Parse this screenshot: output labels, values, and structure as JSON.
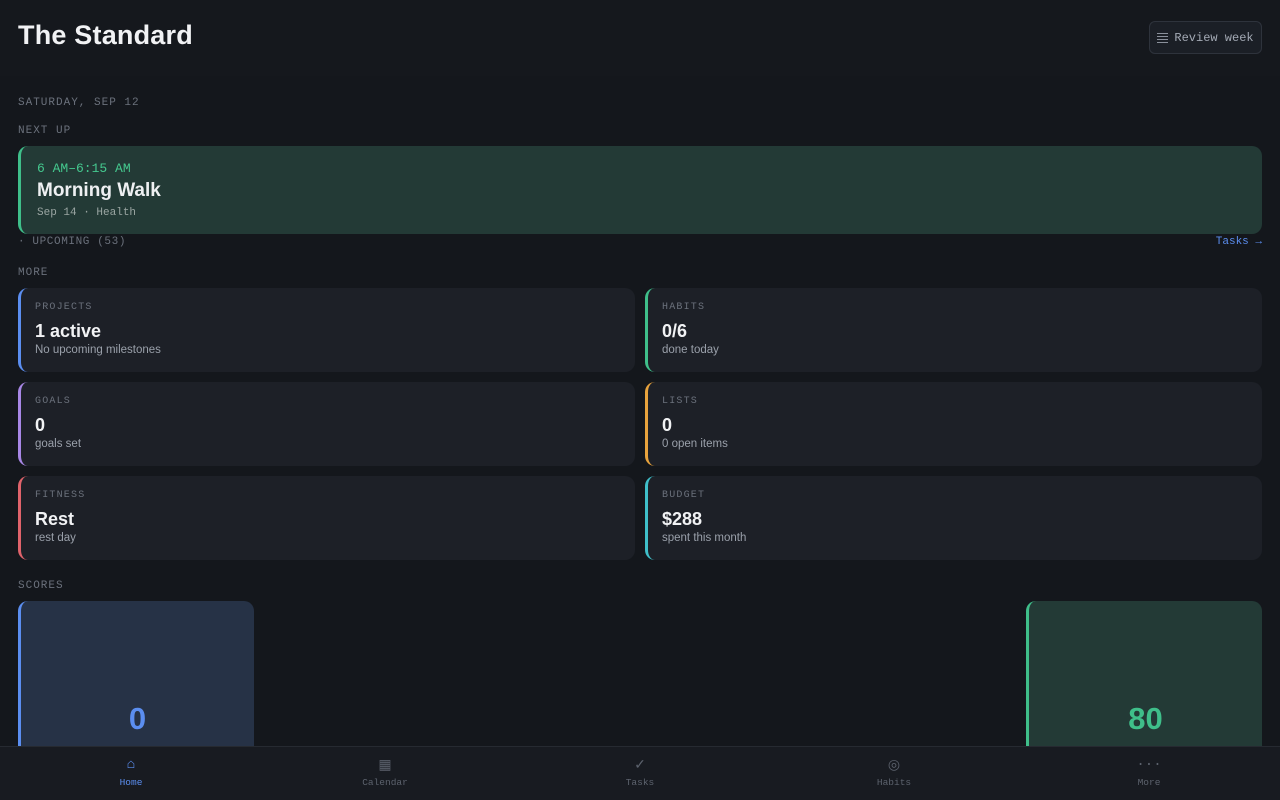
{
  "header": {
    "title": "The Standard",
    "review_label": "Review week",
    "review_icon": "list-icon"
  },
  "date_label": "SATURDAY, SEP 12",
  "next_up": {
    "section_label": "NEXT UP",
    "time": "6 AM–6:15 AM",
    "title": "Morning Walk",
    "meta": "Sep 14 · Health",
    "accent": "#3fbf8a"
  },
  "upcoming": {
    "label": "· UPCOMING (53)",
    "tasks_link": "Tasks →"
  },
  "more": {
    "section_label": "MORE",
    "tiles": [
      {
        "label": "PROJECTS",
        "value": "1 active",
        "sub": "No upcoming milestones",
        "accent": "#5b8ef0"
      },
      {
        "label": "HABITS",
        "value": "0/6",
        "sub": "done today",
        "accent": "#3fbf8a"
      },
      {
        "label": "GOALS",
        "value": "0",
        "sub": "goals set",
        "accent": "#a887e6"
      },
      {
        "label": "LISTS",
        "value": "0",
        "sub": "0 open items",
        "accent": "#e8a33d"
      },
      {
        "label": "FITNESS",
        "value": "Rest",
        "sub": "rest day",
        "accent": "#e0636b"
      },
      {
        "label": "BUDGET",
        "value": "$288",
        "sub": "spent this month",
        "accent": "#3fbfc9"
      }
    ]
  },
  "scores": {
    "section_label": "SCORES",
    "items": [
      {
        "value": "0",
        "color": "#5b8ef0",
        "bg": "#263246"
      },
      {
        "value": "80",
        "color": "#3fbf8a",
        "bg": "#233a36"
      }
    ]
  },
  "nav": {
    "items": [
      {
        "label": "Home",
        "icon": "home-icon",
        "glyph": "⌂",
        "active": true
      },
      {
        "label": "Calendar",
        "icon": "calendar-icon",
        "glyph": "▦",
        "active": false
      },
      {
        "label": "Tasks",
        "icon": "check-icon",
        "glyph": "✓",
        "active": false
      },
      {
        "label": "Habits",
        "icon": "target-icon",
        "glyph": "◎",
        "active": false
      },
      {
        "label": "More",
        "icon": "more-icon",
        "glyph": "···",
        "active": false
      }
    ]
  }
}
